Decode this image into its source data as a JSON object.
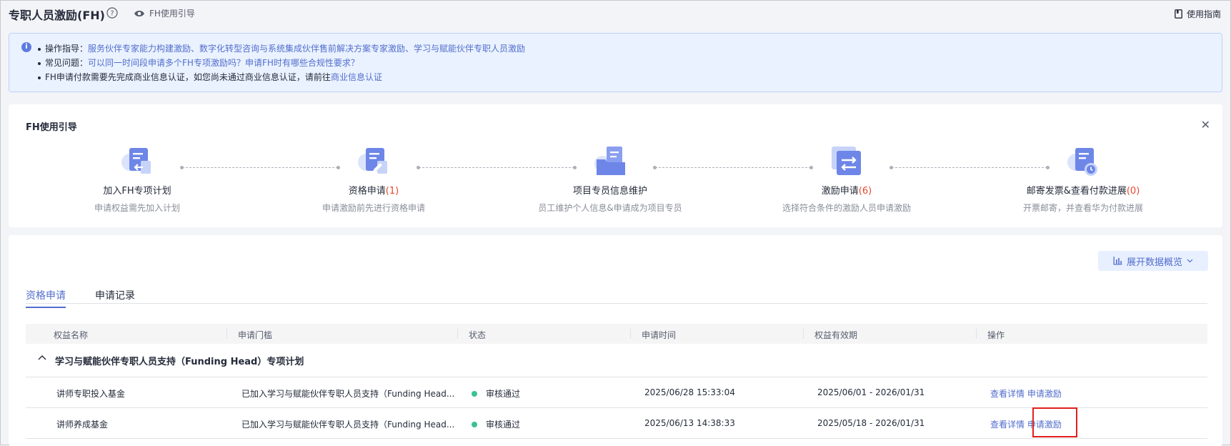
{
  "header": {
    "title": "专职人员激励(FH)",
    "guide_link": "FH使用引导",
    "manual_link": "使用指南"
  },
  "info": {
    "line1_prefix": "操作指导：",
    "line1_link": "服务伙伴专家能力构建激励、数字化转型咨询与系统集成伙伴售前解决方案专家激励、学习与赋能伙伴专职人员激励",
    "line2_prefix": "常见问题：",
    "line2_link": "可以同一时间段申请多个FH专项激励吗？申请FH时有哪些合规性要求？",
    "line3_text": "FH申请付款需要先完成商业信息认证，如您尚未通过商业信息认证，请前往",
    "line3_link": "商业信息认证"
  },
  "guide": {
    "title": "FH使用引导",
    "steps": [
      {
        "name": "加入FH专项计划",
        "count": "",
        "desc": "申请权益需先加入计划",
        "icon": "document-arrow-icon"
      },
      {
        "name": "资格申请",
        "count": "(1)",
        "desc": "申请激励前先进行资格申请",
        "icon": "document-edit-icon"
      },
      {
        "name": "项目专员信息维护",
        "count": "",
        "desc": "员工维护个人信息&申请成为项目专员",
        "icon": "folder-document-icon"
      },
      {
        "name": "激励申请",
        "count": "(6)",
        "desc": "选择符合条件的激励人员申请激励",
        "icon": "exchange-icon"
      },
      {
        "name": "邮寄发票&查看付款进展",
        "count": "(0)",
        "desc": "开票邮寄，并查看华为付款进展",
        "icon": "document-clock-icon"
      }
    ]
  },
  "main": {
    "expand_button": "展开数据概览",
    "tabs": [
      "资格申请",
      "申请记录"
    ],
    "active_tab": 0,
    "columns": [
      "权益名称",
      "申请门槛",
      "状态",
      "申请时间",
      "权益有效期",
      "操作"
    ],
    "group_title": "学习与赋能伙伴专职人员支持（Funding Head）专项计划",
    "rows": [
      {
        "name": "讲师专职投入基金",
        "threshold": "已加入学习与赋能伙伴专职人员支持（Funding Head...",
        "status": "审核通过",
        "apply_time": "2025/06/28 15:33:04",
        "validity": "2025/06/01 - 2026/01/31",
        "op_view": "查看详情",
        "op_apply": "申请激励"
      },
      {
        "name": "讲师养成基金",
        "threshold": "已加入学习与赋能伙伴专职人员支持（Funding Head...",
        "status": "审核通过",
        "apply_time": "2025/06/13 14:38:33",
        "validity": "2025/05/18 - 2026/01/31",
        "op_view": "查看详情",
        "op_apply": "申请激励"
      }
    ]
  },
  "colors": {
    "accent": "#526ecc",
    "count_red": "#e8482e",
    "status_green": "#3ac295",
    "highlight_red": "#e0201c"
  }
}
